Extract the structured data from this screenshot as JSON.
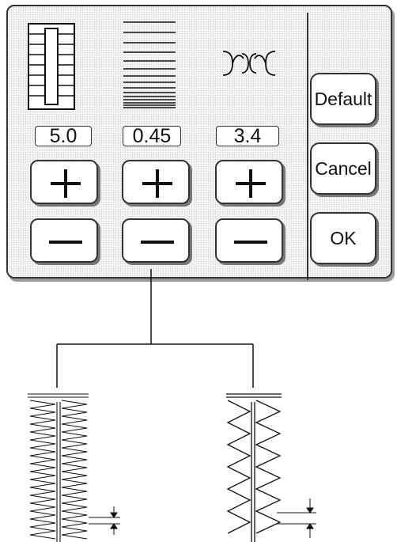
{
  "settings": {
    "width_value": "5.0",
    "length_value": "0.45",
    "density_value": "3.4"
  },
  "side_buttons": {
    "default_label": "Default",
    "cancel_label": "Cancel",
    "ok_label": "OK"
  },
  "icons": {
    "width": "buttonhole-width-icon",
    "length": "stitch-length-icon",
    "density": "bartack-density-icon",
    "plus": "plus-icon",
    "minus": "minus-icon"
  }
}
